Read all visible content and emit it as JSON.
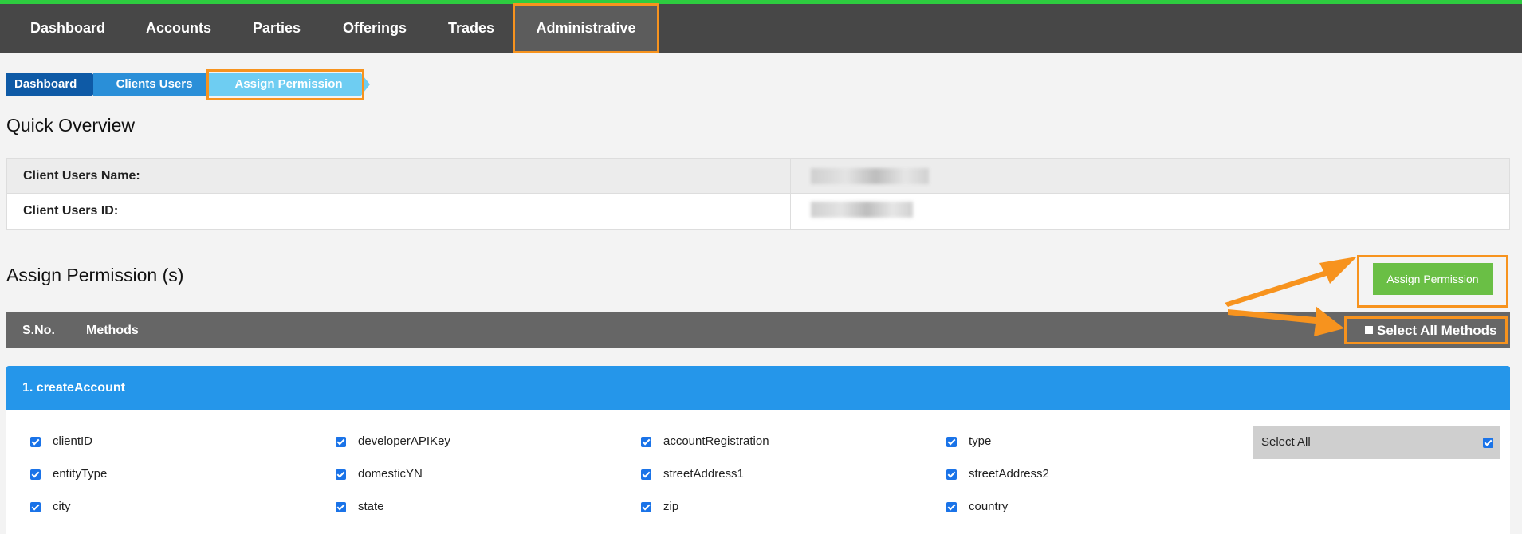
{
  "nav": {
    "items": [
      "Dashboard",
      "Accounts",
      "Parties",
      "Offerings",
      "Trades",
      "Administrative"
    ],
    "active": "Administrative"
  },
  "breadcrumb": [
    "Dashboard",
    "Clients Users",
    "Assign Permission"
  ],
  "overview": {
    "title": "Quick Overview",
    "rows": [
      {
        "label": "Client Users Name:"
      },
      {
        "label": "Client Users ID:"
      }
    ]
  },
  "assign": {
    "title": "Assign Permission (s)",
    "button_label": "Assign Permission"
  },
  "methods_table": {
    "col_sno": "S.No.",
    "col_methods": "Methods",
    "select_all_methods": "Select All Methods"
  },
  "method": {
    "title": "1. createAccount",
    "fields": [
      [
        "clientID",
        "developerAPIKey",
        "accountRegistration",
        "type"
      ],
      [
        "entityType",
        "domesticYN",
        "streetAddress1",
        "streetAddress2"
      ],
      [
        "city",
        "state",
        "zip",
        "country"
      ]
    ],
    "select_all_label": "Select All"
  },
  "colors": {
    "nav_bg": "#474747",
    "accent_green": "#6abf45",
    "method_header_blue": "#2596ea",
    "annotation_orange": "#f7931e"
  }
}
